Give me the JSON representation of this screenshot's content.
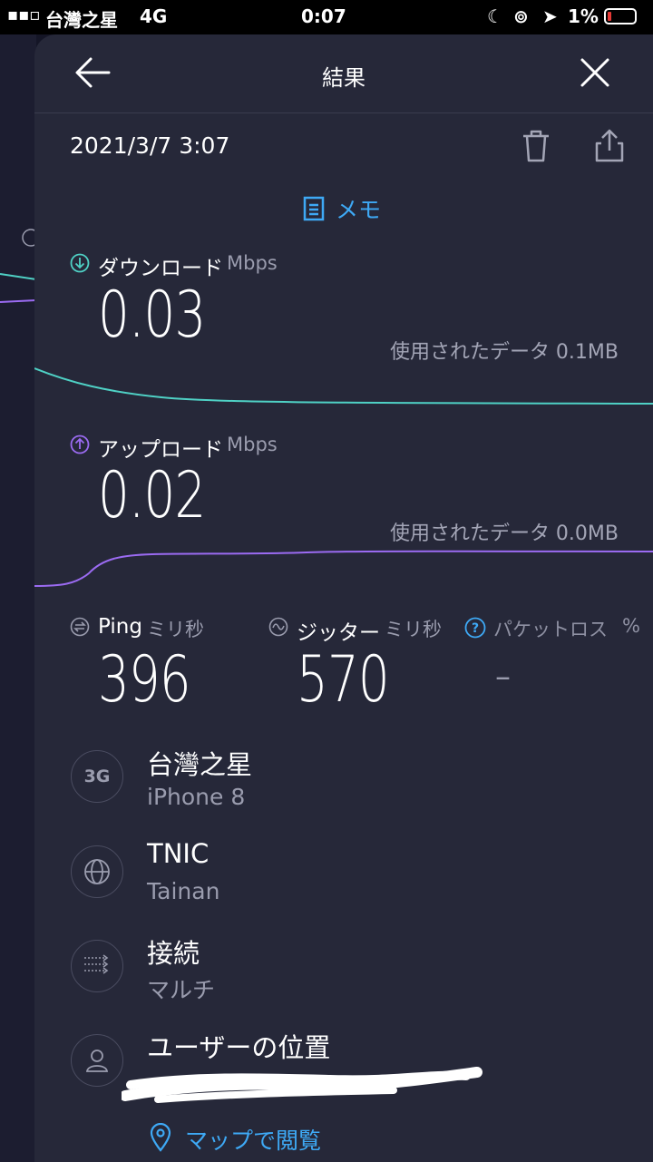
{
  "status_bar": {
    "carrier": "台灣之星",
    "network": "4G",
    "time": "0:07",
    "battery": "1%"
  },
  "header": {
    "title": "結果"
  },
  "result": {
    "date": "2021/3/7 3:07",
    "memo_label": "メモ",
    "download": {
      "label": "ダウンロード",
      "unit": "Mbps",
      "value": "0.03",
      "data_used": "使用されたデータ 0.1MB"
    },
    "upload": {
      "label": "アップロード",
      "unit": "Mbps",
      "value": "0.02",
      "data_used": "使用されたデータ 0.0MB"
    },
    "ping": {
      "label": "Ping",
      "unit": "ミリ秒",
      "value": "396"
    },
    "jitter": {
      "label": "ジッター",
      "unit": "ミリ秒",
      "value": "570"
    },
    "packet_loss": {
      "label": "パケットロス",
      "unit": "%",
      "value": "–"
    }
  },
  "details": [
    {
      "badge": "3G",
      "icon": "network-3g-icon",
      "title": "台灣之星",
      "subtitle": "iPhone 8"
    },
    {
      "badge": "",
      "icon": "globe-icon",
      "title": "TNIC",
      "subtitle": "Tainan"
    },
    {
      "badge": "",
      "icon": "connections-icon",
      "title": "接続",
      "subtitle": "マルチ"
    },
    {
      "badge": "",
      "icon": "user-icon",
      "title": "ユーザーの位置",
      "subtitle": ""
    }
  ],
  "map_link": {
    "label": "マップで閲覧"
  },
  "colors": {
    "accent_blue": "#3ea9f5",
    "download_line": "#4fd1c5",
    "upload_line": "#9b6bf2",
    "card_bg": "#262839"
  }
}
